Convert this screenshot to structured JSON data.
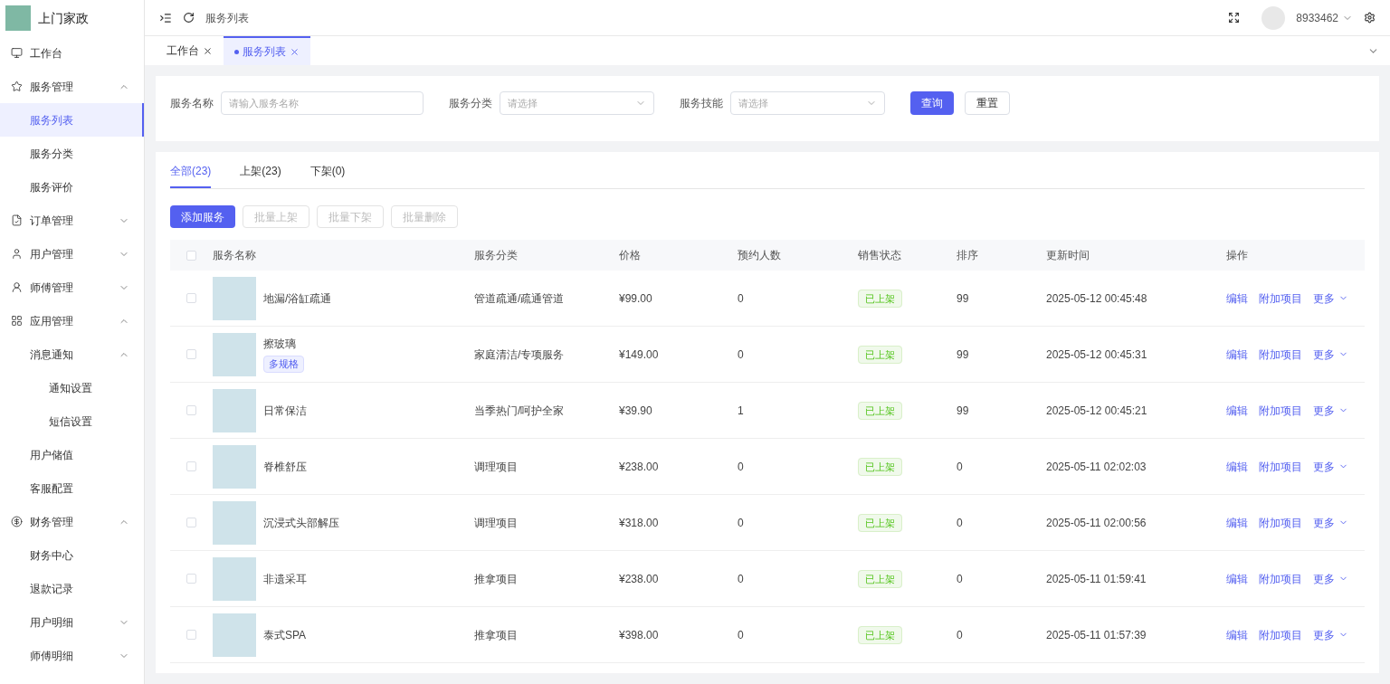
{
  "brand": {
    "title": "上门家政"
  },
  "sidebar": {
    "items": [
      {
        "label": "工作台",
        "selected": false
      },
      {
        "label": "服务管理",
        "selected": false,
        "expanded": true,
        "children": [
          {
            "label": "服务列表",
            "selected": true
          },
          {
            "label": "服务分类",
            "selected": false
          },
          {
            "label": "服务评价",
            "selected": false
          }
        ]
      },
      {
        "label": "订单管理",
        "selected": false,
        "expanded": false
      },
      {
        "label": "用户管理",
        "selected": false,
        "expanded": false
      },
      {
        "label": "师傅管理",
        "selected": false,
        "expanded": false
      },
      {
        "label": "应用管理",
        "selected": false,
        "expanded": true,
        "children": [
          {
            "label": "消息通知",
            "selected": false,
            "expanded": true,
            "children": [
              {
                "label": "通知设置",
                "selected": false
              },
              {
                "label": "短信设置",
                "selected": false
              }
            ]
          },
          {
            "label": "用户储值",
            "selected": false
          },
          {
            "label": "客服配置",
            "selected": false
          }
        ]
      },
      {
        "label": "财务管理",
        "selected": false,
        "expanded": true,
        "children": [
          {
            "label": "财务中心",
            "selected": false
          },
          {
            "label": "退款记录",
            "selected": false
          },
          {
            "label": "用户明细",
            "selected": false,
            "expanded": false
          },
          {
            "label": "师傅明细",
            "selected": false,
            "expanded": false
          }
        ]
      }
    ]
  },
  "header": {
    "breadcrumb": "服务列表",
    "user": "8933462"
  },
  "page_tabs": [
    {
      "label": "工作台",
      "selected": false
    },
    {
      "label": "服务列表",
      "selected": true
    }
  ],
  "filters": [
    {
      "label": "服务名称",
      "kind": "input",
      "placeholder": "请输入服务名称"
    },
    {
      "label": "服务分类",
      "kind": "select",
      "placeholder": "请选择"
    },
    {
      "label": "服务技能",
      "kind": "select",
      "placeholder": "请选择"
    }
  ],
  "filter_buttons": [
    {
      "label": "查询",
      "primary": true
    },
    {
      "label": "重置",
      "primary": false
    }
  ],
  "status_tabs": [
    {
      "label": "全部(23)",
      "selected": true
    },
    {
      "label": "上架(23)",
      "selected": false
    },
    {
      "label": "下架(0)",
      "selected": false
    }
  ],
  "actions": [
    {
      "label": "添加服务",
      "disabled": false
    },
    {
      "label": "批量上架",
      "disabled": true
    },
    {
      "label": "批量下架",
      "disabled": true
    },
    {
      "label": "批量删除",
      "disabled": true
    }
  ],
  "table": {
    "all_checked": false,
    "columns": [
      "服务名称",
      "服务分类",
      "价格",
      "预约人数",
      "销售状态",
      "排序",
      "更新时间",
      "操作"
    ],
    "rows": [
      {
        "checked": false,
        "name": "地漏/浴缸疏通",
        "tags": [],
        "category": "管道疏通/疏通管道",
        "price": "¥99.00",
        "bookings": "0",
        "status": "已上架",
        "sort": "99",
        "updated": "2025-05-12 00:45:48",
        "ops": [
          "编辑",
          "附加项目",
          "更多"
        ]
      },
      {
        "checked": false,
        "name": "擦玻璃",
        "tags": [
          "多规格"
        ],
        "category": "家庭清洁/专项服务",
        "price": "¥149.00",
        "bookings": "0",
        "status": "已上架",
        "sort": "99",
        "updated": "2025-05-12 00:45:31",
        "ops": [
          "编辑",
          "附加项目",
          "更多"
        ]
      },
      {
        "checked": false,
        "name": "日常保洁",
        "tags": [],
        "category": "当季热门/呵护全家",
        "price": "¥39.90",
        "bookings": "1",
        "status": "已上架",
        "sort": "99",
        "updated": "2025-05-12 00:45:21",
        "ops": [
          "编辑",
          "附加项目",
          "更多"
        ]
      },
      {
        "checked": false,
        "name": "脊椎舒压",
        "tags": [],
        "category": "调理项目",
        "price": "¥238.00",
        "bookings": "0",
        "status": "已上架",
        "sort": "0",
        "updated": "2025-05-11 02:02:03",
        "ops": [
          "编辑",
          "附加项目",
          "更多"
        ]
      },
      {
        "checked": false,
        "name": "沉浸式头部解压",
        "tags": [],
        "category": "调理项目",
        "price": "¥318.00",
        "bookings": "0",
        "status": "已上架",
        "sort": "0",
        "updated": "2025-05-11 02:00:56",
        "ops": [
          "编辑",
          "附加项目",
          "更多"
        ]
      },
      {
        "checked": false,
        "name": "非遗采耳",
        "tags": [],
        "category": "推拿项目",
        "price": "¥238.00",
        "bookings": "0",
        "status": "已上架",
        "sort": "0",
        "updated": "2025-05-11 01:59:41",
        "ops": [
          "编辑",
          "附加项目",
          "更多"
        ]
      },
      {
        "checked": false,
        "name": "泰式SPA",
        "tags": [],
        "category": "推拿项目",
        "price": "¥398.00",
        "bookings": "0",
        "status": "已上架",
        "sort": "0",
        "updated": "2025-05-11 01:57:39",
        "ops": [
          "编辑",
          "附加项目",
          "更多"
        ]
      }
    ]
  }
}
